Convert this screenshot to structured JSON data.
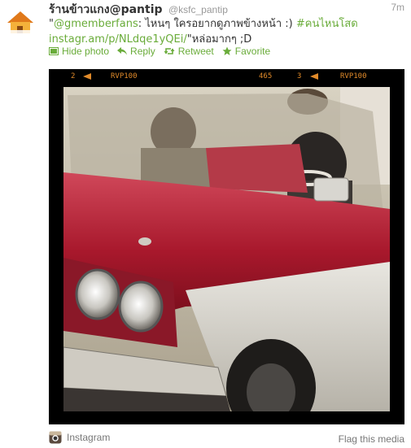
{
  "tweet": {
    "display_name": "ร้านข้าวแกง@pantip",
    "handle": "@ksfc_pantip",
    "time": "7m",
    "avatar_label": "ร้านข้าวแกง @pantip",
    "text_parts": {
      "mention": "@gmemberfans",
      "text1": ": ไหนๆ ใครอยากดูภาพข้างหน้า :) ",
      "hashtag": "#คนไหนโสด",
      "link": "instagr.am/p/NLdqe1yQEi/",
      "text2": "\"หล่อมากๆ ;D",
      "open_quote": "\""
    }
  },
  "actions": {
    "hide_photo": "Hide photo",
    "reply": "Reply",
    "retweet": "Retweet",
    "favorite": "Favorite"
  },
  "media": {
    "film_labels": [
      "2",
      "RVP100",
      "465",
      "3",
      "RVP100"
    ]
  },
  "footer": {
    "source": "Instagram",
    "flag": "Flag this media"
  },
  "colors": {
    "link": "#6aac3a",
    "film_text": "#e08a2a"
  }
}
